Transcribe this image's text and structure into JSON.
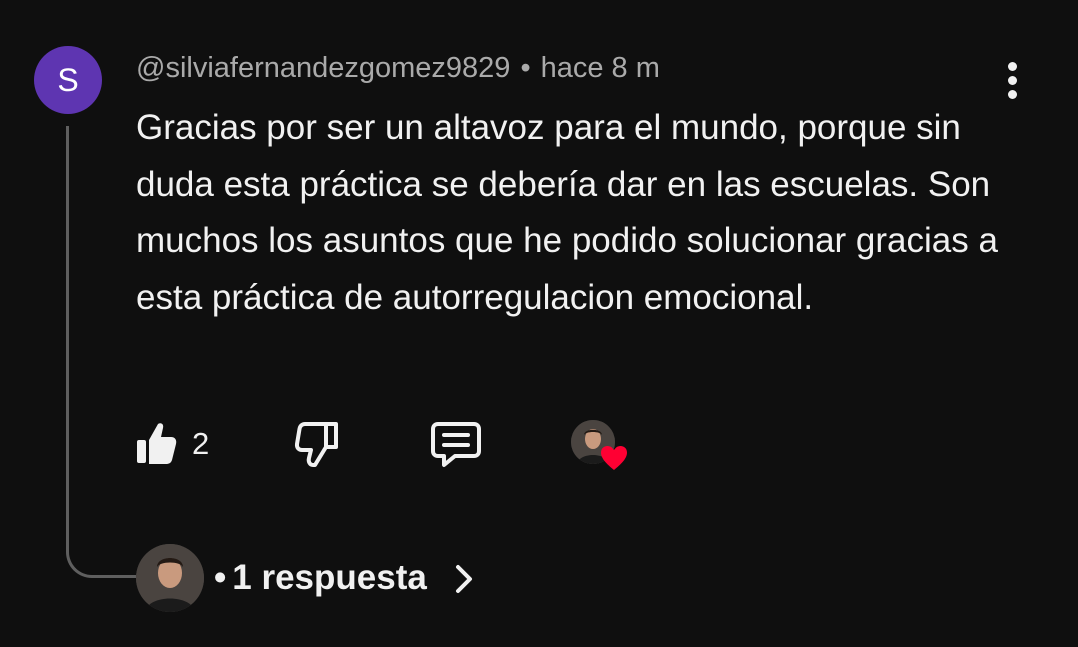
{
  "comment": {
    "avatar_letter": "S",
    "avatar_color": "#5e35b1",
    "username": "@silviafernandezgomez9829",
    "separator": "•",
    "time": "hace 8 m",
    "text": "Gracias por ser un altavoz para el mundo, porque sin duda esta práctica se debería dar en las escuelas. Son muchos los asuntos que he podido solucionar gracias a esta práctica de autorregulacion emocional.",
    "more_icon": "more-vertical-icon"
  },
  "actions": {
    "like_icon": "thumbs-up-icon",
    "like_count": "2",
    "dislike_icon": "thumbs-down-icon",
    "reply_icon": "comment-reply-icon",
    "creator_heart_icon": "heart-icon",
    "heart_color": "#ff0033"
  },
  "replies": {
    "separator": "•",
    "label": "1 respuesta",
    "chevron_icon": "chevron-right-icon"
  }
}
